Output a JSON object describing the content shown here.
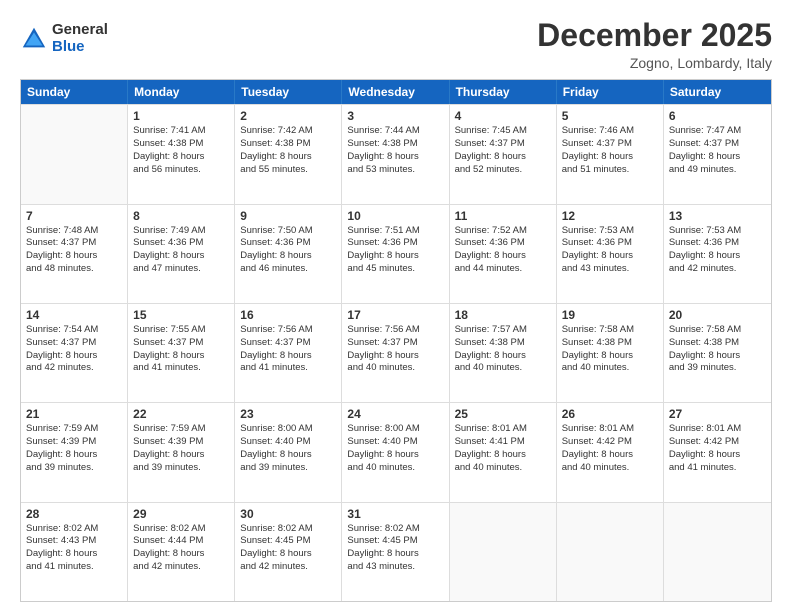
{
  "logo": {
    "general": "General",
    "blue": "Blue"
  },
  "title": "December 2025",
  "location": "Zogno, Lombardy, Italy",
  "header_days": [
    "Sunday",
    "Monday",
    "Tuesday",
    "Wednesday",
    "Thursday",
    "Friday",
    "Saturday"
  ],
  "weeks": [
    [
      {
        "day": "",
        "empty": true
      },
      {
        "day": "1",
        "line1": "Sunrise: 7:41 AM",
        "line2": "Sunset: 4:38 PM",
        "line3": "Daylight: 8 hours",
        "line4": "and 56 minutes."
      },
      {
        "day": "2",
        "line1": "Sunrise: 7:42 AM",
        "line2": "Sunset: 4:38 PM",
        "line3": "Daylight: 8 hours",
        "line4": "and 55 minutes."
      },
      {
        "day": "3",
        "line1": "Sunrise: 7:44 AM",
        "line2": "Sunset: 4:38 PM",
        "line3": "Daylight: 8 hours",
        "line4": "and 53 minutes."
      },
      {
        "day": "4",
        "line1": "Sunrise: 7:45 AM",
        "line2": "Sunset: 4:37 PM",
        "line3": "Daylight: 8 hours",
        "line4": "and 52 minutes."
      },
      {
        "day": "5",
        "line1": "Sunrise: 7:46 AM",
        "line2": "Sunset: 4:37 PM",
        "line3": "Daylight: 8 hours",
        "line4": "and 51 minutes."
      },
      {
        "day": "6",
        "line1": "Sunrise: 7:47 AM",
        "line2": "Sunset: 4:37 PM",
        "line3": "Daylight: 8 hours",
        "line4": "and 49 minutes."
      }
    ],
    [
      {
        "day": "7",
        "line1": "Sunrise: 7:48 AM",
        "line2": "Sunset: 4:37 PM",
        "line3": "Daylight: 8 hours",
        "line4": "and 48 minutes."
      },
      {
        "day": "8",
        "line1": "Sunrise: 7:49 AM",
        "line2": "Sunset: 4:36 PM",
        "line3": "Daylight: 8 hours",
        "line4": "and 47 minutes."
      },
      {
        "day": "9",
        "line1": "Sunrise: 7:50 AM",
        "line2": "Sunset: 4:36 PM",
        "line3": "Daylight: 8 hours",
        "line4": "and 46 minutes."
      },
      {
        "day": "10",
        "line1": "Sunrise: 7:51 AM",
        "line2": "Sunset: 4:36 PM",
        "line3": "Daylight: 8 hours",
        "line4": "and 45 minutes."
      },
      {
        "day": "11",
        "line1": "Sunrise: 7:52 AM",
        "line2": "Sunset: 4:36 PM",
        "line3": "Daylight: 8 hours",
        "line4": "and 44 minutes."
      },
      {
        "day": "12",
        "line1": "Sunrise: 7:53 AM",
        "line2": "Sunset: 4:36 PM",
        "line3": "Daylight: 8 hours",
        "line4": "and 43 minutes."
      },
      {
        "day": "13",
        "line1": "Sunrise: 7:53 AM",
        "line2": "Sunset: 4:36 PM",
        "line3": "Daylight: 8 hours",
        "line4": "and 42 minutes."
      }
    ],
    [
      {
        "day": "14",
        "line1": "Sunrise: 7:54 AM",
        "line2": "Sunset: 4:37 PM",
        "line3": "Daylight: 8 hours",
        "line4": "and 42 minutes."
      },
      {
        "day": "15",
        "line1": "Sunrise: 7:55 AM",
        "line2": "Sunset: 4:37 PM",
        "line3": "Daylight: 8 hours",
        "line4": "and 41 minutes."
      },
      {
        "day": "16",
        "line1": "Sunrise: 7:56 AM",
        "line2": "Sunset: 4:37 PM",
        "line3": "Daylight: 8 hours",
        "line4": "and 41 minutes."
      },
      {
        "day": "17",
        "line1": "Sunrise: 7:56 AM",
        "line2": "Sunset: 4:37 PM",
        "line3": "Daylight: 8 hours",
        "line4": "and 40 minutes."
      },
      {
        "day": "18",
        "line1": "Sunrise: 7:57 AM",
        "line2": "Sunset: 4:38 PM",
        "line3": "Daylight: 8 hours",
        "line4": "and 40 minutes."
      },
      {
        "day": "19",
        "line1": "Sunrise: 7:58 AM",
        "line2": "Sunset: 4:38 PM",
        "line3": "Daylight: 8 hours",
        "line4": "and 40 minutes."
      },
      {
        "day": "20",
        "line1": "Sunrise: 7:58 AM",
        "line2": "Sunset: 4:38 PM",
        "line3": "Daylight: 8 hours",
        "line4": "and 39 minutes."
      }
    ],
    [
      {
        "day": "21",
        "line1": "Sunrise: 7:59 AM",
        "line2": "Sunset: 4:39 PM",
        "line3": "Daylight: 8 hours",
        "line4": "and 39 minutes."
      },
      {
        "day": "22",
        "line1": "Sunrise: 7:59 AM",
        "line2": "Sunset: 4:39 PM",
        "line3": "Daylight: 8 hours",
        "line4": "and 39 minutes."
      },
      {
        "day": "23",
        "line1": "Sunrise: 8:00 AM",
        "line2": "Sunset: 4:40 PM",
        "line3": "Daylight: 8 hours",
        "line4": "and 39 minutes."
      },
      {
        "day": "24",
        "line1": "Sunrise: 8:00 AM",
        "line2": "Sunset: 4:40 PM",
        "line3": "Daylight: 8 hours",
        "line4": "and 40 minutes."
      },
      {
        "day": "25",
        "line1": "Sunrise: 8:01 AM",
        "line2": "Sunset: 4:41 PM",
        "line3": "Daylight: 8 hours",
        "line4": "and 40 minutes."
      },
      {
        "day": "26",
        "line1": "Sunrise: 8:01 AM",
        "line2": "Sunset: 4:42 PM",
        "line3": "Daylight: 8 hours",
        "line4": "and 40 minutes."
      },
      {
        "day": "27",
        "line1": "Sunrise: 8:01 AM",
        "line2": "Sunset: 4:42 PM",
        "line3": "Daylight: 8 hours",
        "line4": "and 41 minutes."
      }
    ],
    [
      {
        "day": "28",
        "line1": "Sunrise: 8:02 AM",
        "line2": "Sunset: 4:43 PM",
        "line3": "Daylight: 8 hours",
        "line4": "and 41 minutes."
      },
      {
        "day": "29",
        "line1": "Sunrise: 8:02 AM",
        "line2": "Sunset: 4:44 PM",
        "line3": "Daylight: 8 hours",
        "line4": "and 42 minutes."
      },
      {
        "day": "30",
        "line1": "Sunrise: 8:02 AM",
        "line2": "Sunset: 4:45 PM",
        "line3": "Daylight: 8 hours",
        "line4": "and 42 minutes."
      },
      {
        "day": "31",
        "line1": "Sunrise: 8:02 AM",
        "line2": "Sunset: 4:45 PM",
        "line3": "Daylight: 8 hours",
        "line4": "and 43 minutes."
      },
      {
        "day": "",
        "empty": true
      },
      {
        "day": "",
        "empty": true
      },
      {
        "day": "",
        "empty": true
      }
    ]
  ]
}
